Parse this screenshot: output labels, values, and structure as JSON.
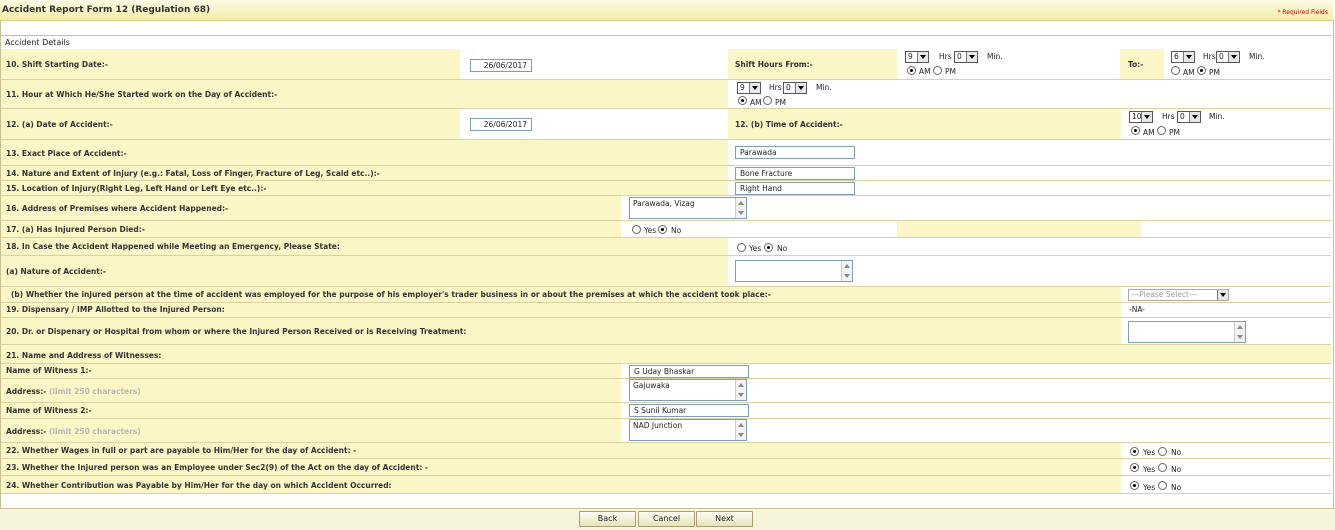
{
  "form": {
    "title": "Accident Report Form 12 (Regulation 68)",
    "required_note": "* Required Fields",
    "section_title": "Accident Details"
  },
  "fields": {
    "shift_start_date": {
      "label": "10. Shift Starting Date:-",
      "value": "26/06/2017"
    },
    "shift_hours_from": {
      "label": "Shift Hours From:-",
      "hrs": "9",
      "min": "0",
      "hrs_unit": "Hrs",
      "min_unit": "Min.",
      "am": "AM",
      "pm": "PM",
      "selected": "AM"
    },
    "shift_hours_to": {
      "label": "To:-",
      "hrs": "6",
      "min": "0",
      "hrs_unit": "Hrs",
      "min_unit": "Min.",
      "am": "AM",
      "pm": "PM",
      "selected": "PM"
    },
    "hour_started": {
      "label": "11. Hour at Which He/She Started work on the Day of Accident:-",
      "hrs": "9",
      "min": "0",
      "hrs_unit": "Hrs",
      "min_unit": "Min.",
      "am": "AM",
      "pm": "PM",
      "selected": "AM"
    },
    "date_of_accident": {
      "label": "12. (a) Date of Accident:-",
      "value": "26/06/2017"
    },
    "time_of_accident": {
      "label": "12. (b) Time of Accident:-",
      "hrs": "10",
      "min": "0",
      "hrs_unit": "Hrs",
      "min_unit": "Min.",
      "am": "AM",
      "pm": "PM",
      "selected": "AM"
    },
    "exact_place": {
      "label": "13. Exact Place of Accident:-",
      "value": "Parawada"
    },
    "nature_injury": {
      "label": "14. Nature and Extent of Injury (e.g.: Fatal, Loss of Finger, Fracture of Leg, Scald etc..):-",
      "value": "Bone Fracture"
    },
    "location_injury": {
      "label": "15. Location of Injury(Right Leg, Left Hand or Left Eye etc..):-",
      "value": "Right Hand"
    },
    "address_premises": {
      "label": "16. Address of Premises where Accident Happened:-",
      "value": "Parawada, Vizag"
    },
    "person_died": {
      "label": "17. (a) Has Injured Person Died:-",
      "yes": "Yes",
      "no": "No",
      "selected": "No"
    },
    "emergency": {
      "label": "18.  In Case the Accident Happened while Meeting an Emergency, Please State:",
      "yes": "Yes",
      "no": "No",
      "selected": "No"
    },
    "nature_accident": {
      "label": "(a) Nature of Accident:-",
      "value": ""
    },
    "employer_trade": {
      "label": "(b) Whether the injured person at the time of accident was employed for the purpose of his employer's trader business in or about the premises at which the accident took place:-",
      "value": "---Please Select---"
    },
    "dispensary": {
      "label": "19. Dispensary / IMP Allotted to the Injured Person:",
      "value": "-NA-"
    },
    "doctor": {
      "label": "20. Dr. or Dispenary or Hospital from whom or where the Injured Person Received or is Receiving Treatment:",
      "value": ""
    },
    "witnesses_heading": {
      "label": "21. Name and Address of Witnesses:"
    },
    "witness1_name": {
      "label": "Name of Witness 1:-",
      "value": "G Uday Bhaskar"
    },
    "witness1_address": {
      "label": "Address:-",
      "hint": "(limit 250 characters)",
      "value": "Gajuwaka"
    },
    "witness2_name": {
      "label": "Name of Witness 2:-",
      "value": "S Sunil Kumar"
    },
    "witness2_address": {
      "label": "Address:-",
      "hint": "(limit 250 characters)",
      "value": "NAD Junction"
    },
    "wages_payable": {
      "label": "22. Whether Wages in full or part are payable to Him/Her for the day of Accident: -",
      "yes": "Yes",
      "no": "No",
      "selected": "Yes"
    },
    "employee_sec2": {
      "label": "23. Whether the Injured person was an Employee under Sec2(9) of the Act on the day of Accident: -",
      "yes": "Yes",
      "no": "No",
      "selected": "Yes"
    },
    "contribution": {
      "label": "24. Whether Contribution was Payable by Him/Her for the day on which Accident Occurred:",
      "yes": "Yes",
      "no": "No",
      "selected": "Yes"
    }
  },
  "buttons": {
    "back": "Back",
    "cancel": "Cancel",
    "next": "Next"
  },
  "colors": {
    "row_yellow": "#faf6c6",
    "border": "#d7d1a4",
    "required": "#cc0000"
  }
}
